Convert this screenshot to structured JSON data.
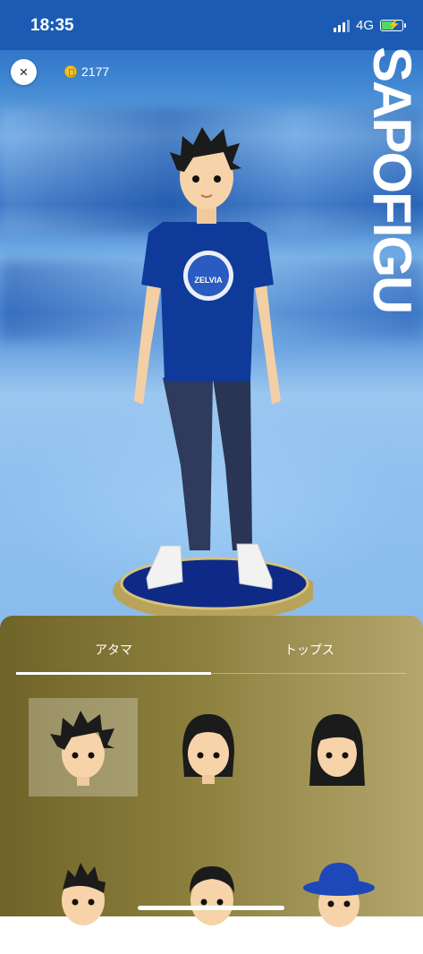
{
  "status_bar": {
    "time": "18:35",
    "network": "4G"
  },
  "header": {
    "close_label": "×",
    "coin_count": "2177"
  },
  "brand": {
    "text": "SAPOFIGU"
  },
  "avatar": {
    "shirt_text": "ZELVIA",
    "shirt_color": "#0f3a9a"
  },
  "tabs": [
    {
      "label": "アタマ",
      "active": true
    },
    {
      "label": "トップス",
      "active": false
    }
  ],
  "head_items": [
    {
      "name": "spiky-short-hair",
      "selected": true
    },
    {
      "name": "bob-bangs-hair",
      "selected": false
    },
    {
      "name": "long-straight-hair",
      "selected": false
    },
    {
      "name": "mohawk-hair",
      "selected": false
    },
    {
      "name": "short-crop-hair",
      "selected": false
    },
    {
      "name": "bucket-hat",
      "selected": false
    }
  ],
  "colors": {
    "status_bar": "#1b5bb3",
    "panel_left": "#6f6428",
    "panel_right": "#b4a66c",
    "battery": "#4cd964",
    "coin": "#f2c530"
  }
}
